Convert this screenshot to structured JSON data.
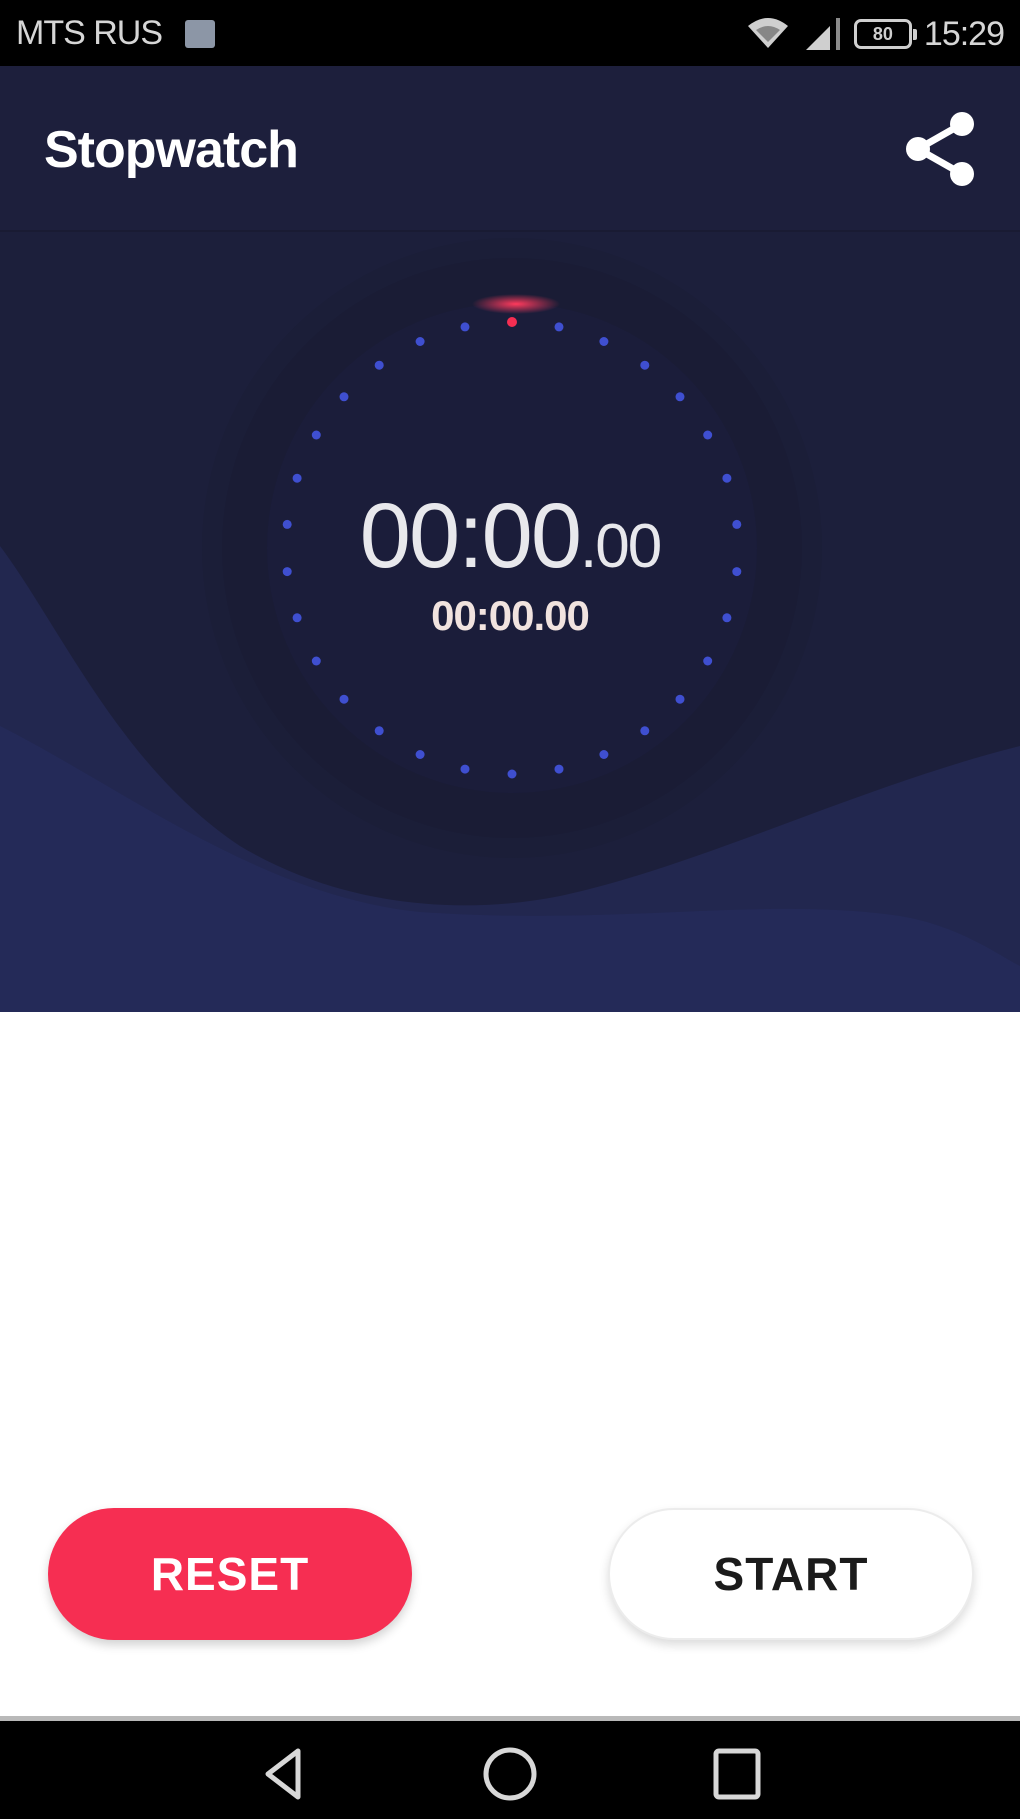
{
  "status_bar": {
    "carrier": "MTS RUS",
    "battery": "80",
    "time": "15:29",
    "icons": [
      "image-notification-icon",
      "wifi-icon",
      "signal-icon",
      "battery-icon"
    ]
  },
  "app_bar": {
    "title": "Stopwatch",
    "share_icon": "share-icon"
  },
  "stopwatch": {
    "main_time": "00:00",
    "main_centiseconds": ".00",
    "lap_time": "00:00.00",
    "progress_fraction": 0,
    "tick_count": 30,
    "colors": {
      "accent": "#f62e52",
      "tick": "#3f4fd0",
      "background": "#1c1f3b"
    }
  },
  "buttons": {
    "reset": "RESET",
    "start": "START"
  },
  "nav_bar": {
    "back": "back-icon",
    "home": "home-icon",
    "recents": "recents-icon"
  }
}
